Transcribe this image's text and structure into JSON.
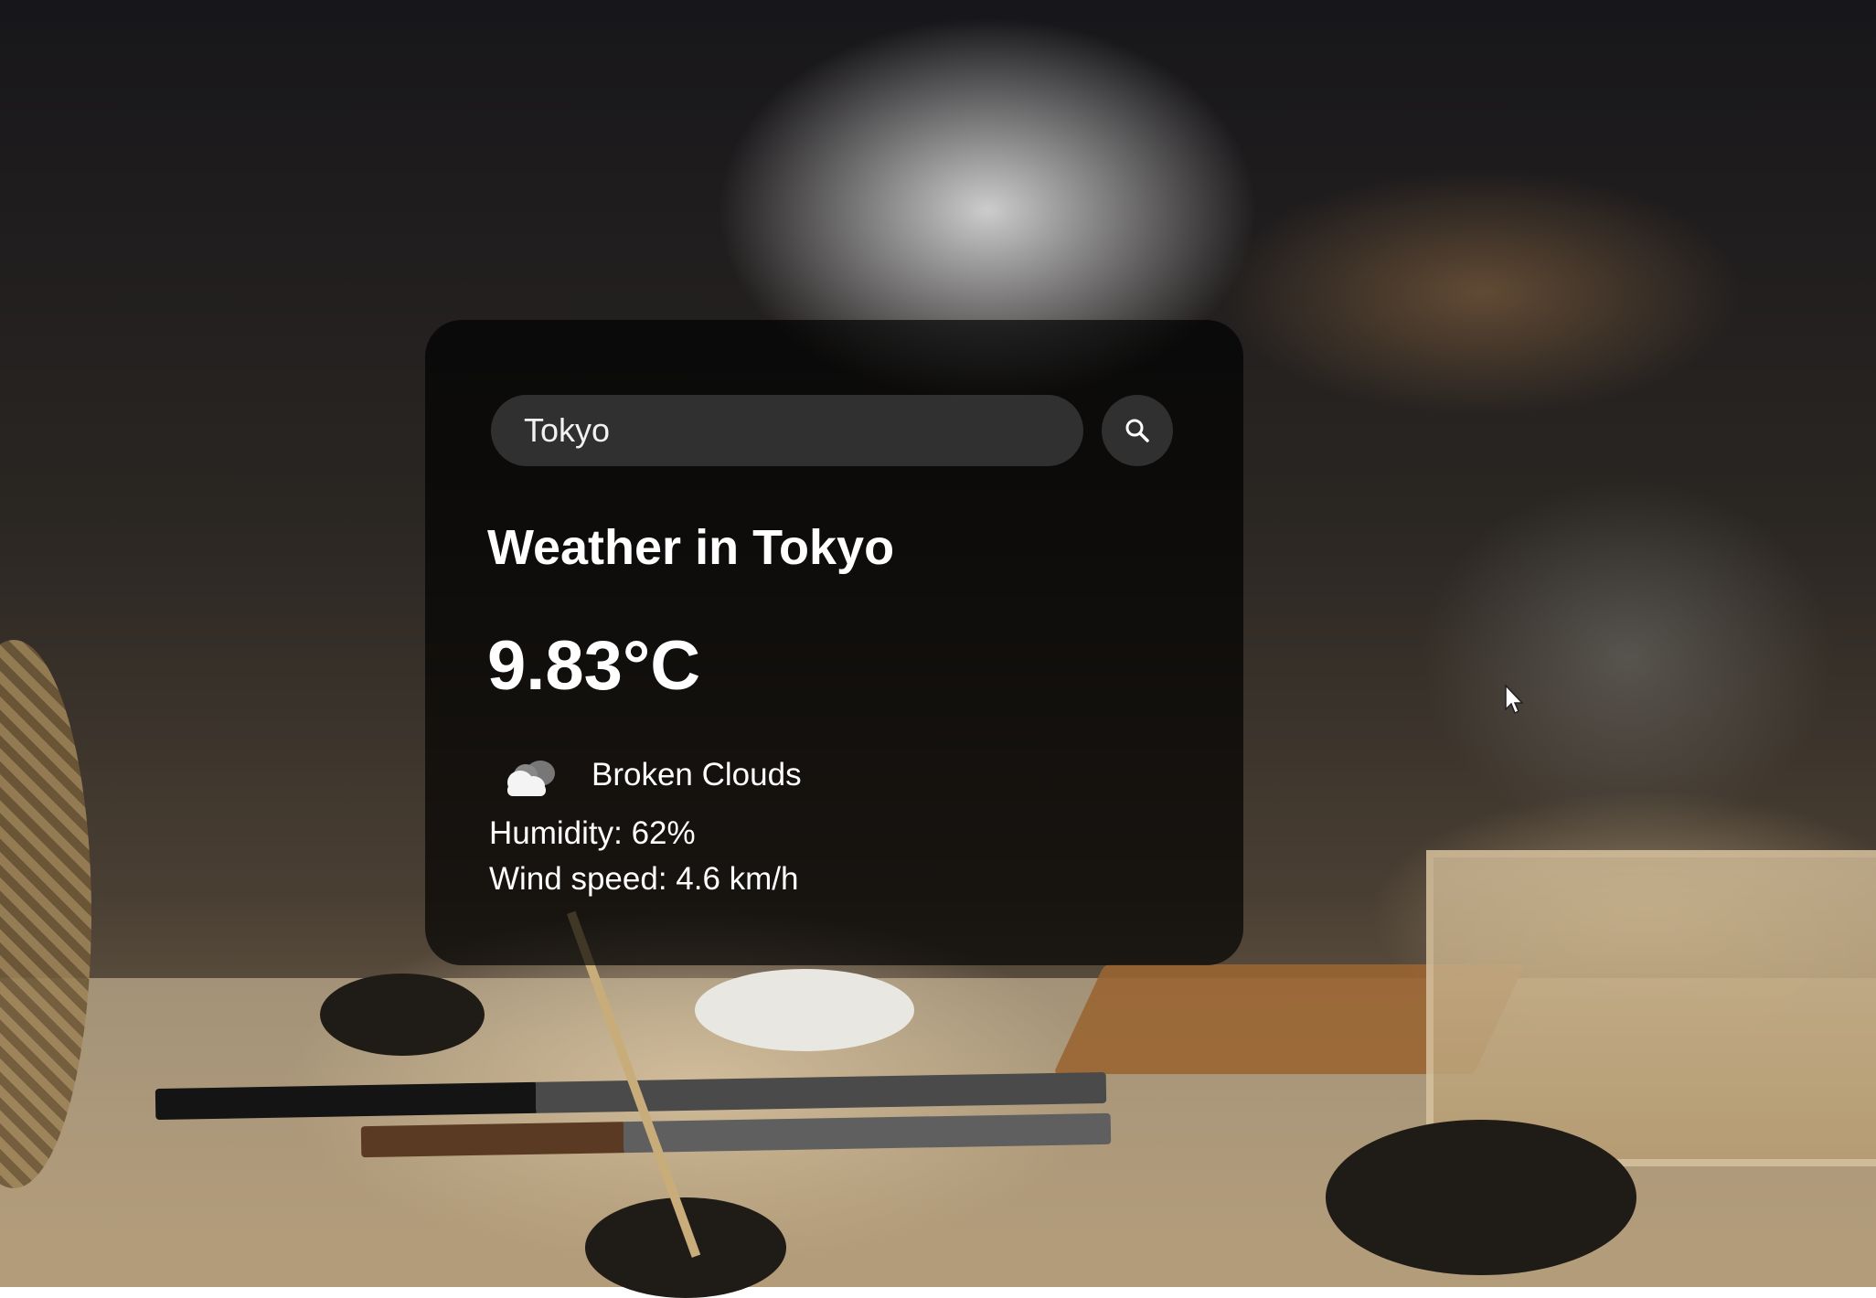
{
  "search": {
    "value": "Tokyo",
    "icon": "search-icon"
  },
  "weather": {
    "title": "Weather in Tokyo",
    "temperature": "9.83°C",
    "icon": "cloud-icon",
    "description": "Broken Clouds",
    "humidity": "Humidity: 62%",
    "wind": "Wind speed: 4.6 km/h"
  },
  "colors": {
    "card_background": "rgba(0,0,0,0.68)",
    "text": "#ffffff",
    "input_background": "rgba(80,80,80,0.55)"
  }
}
